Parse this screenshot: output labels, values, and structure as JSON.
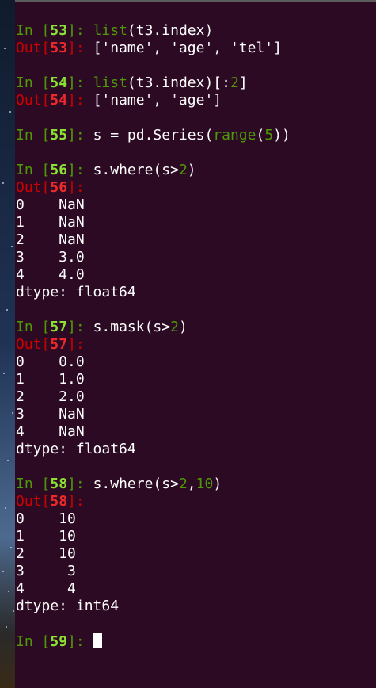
{
  "terminal": {
    "cells": [
      {
        "in_num": "53",
        "code": [
          {
            "text": "list",
            "style": "kw-green"
          },
          {
            "text": "(t3.index)",
            "style": ""
          }
        ],
        "out_num": "53",
        "out_inline": "['name', 'age', 'tel']",
        "out_lines": []
      },
      {
        "in_num": "54",
        "code": [
          {
            "text": "list",
            "style": "kw-green"
          },
          {
            "text": "(t3.index)[:",
            "style": ""
          },
          {
            "text": "2",
            "style": "num-green"
          },
          {
            "text": "]",
            "style": ""
          }
        ],
        "out_num": "54",
        "out_inline": "['name', 'age']",
        "out_lines": []
      },
      {
        "in_num": "55",
        "code": [
          {
            "text": "s = pd.Series(",
            "style": ""
          },
          {
            "text": "range",
            "style": "kw-green"
          },
          {
            "text": "(",
            "style": ""
          },
          {
            "text": "5",
            "style": "num-green"
          },
          {
            "text": "))",
            "style": ""
          }
        ],
        "out_num": null,
        "out_inline": null,
        "out_lines": []
      },
      {
        "in_num": "56",
        "code": [
          {
            "text": "s.where(s>",
            "style": ""
          },
          {
            "text": "2",
            "style": "num-green"
          },
          {
            "text": ")",
            "style": ""
          }
        ],
        "out_num": "56",
        "out_inline": "",
        "out_lines": [
          "0    NaN",
          "1    NaN",
          "2    NaN",
          "3    3.0",
          "4    4.0",
          "dtype: float64"
        ]
      },
      {
        "in_num": "57",
        "code": [
          {
            "text": "s.mask(s>",
            "style": ""
          },
          {
            "text": "2",
            "style": "num-green"
          },
          {
            "text": ")",
            "style": ""
          }
        ],
        "out_num": "57",
        "out_inline": "",
        "out_lines": [
          "0    0.0",
          "1    1.0",
          "2    2.0",
          "3    NaN",
          "4    NaN",
          "dtype: float64"
        ]
      },
      {
        "in_num": "58",
        "code": [
          {
            "text": "s.where(s>",
            "style": ""
          },
          {
            "text": "2",
            "style": "num-green"
          },
          {
            "text": ",",
            "style": ""
          },
          {
            "text": "10",
            "style": "num-green"
          },
          {
            "text": ")",
            "style": ""
          }
        ],
        "out_num": "58",
        "out_inline": "",
        "out_lines": [
          "0    10",
          "1    10",
          "2    10",
          "3     3",
          "4     4",
          "dtype: int64"
        ]
      }
    ],
    "prompt_in_label": "In [",
    "prompt_in_close": "]: ",
    "prompt_out_label": "Out[",
    "prompt_out_close": "]: ",
    "current_prompt_num": "59"
  },
  "colors": {
    "terminal_bg": "#2c0a23",
    "prompt_in": "#4e9a06",
    "prompt_in_num": "#8ae234",
    "prompt_out": "#cc0000",
    "prompt_out_num": "#ef2929",
    "text": "#ffffff"
  }
}
